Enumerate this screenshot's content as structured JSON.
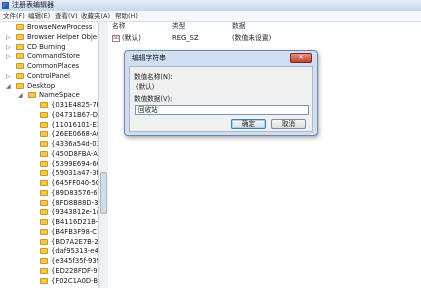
{
  "window": {
    "title": "注册表编辑器"
  },
  "menu": [
    "文件(F)",
    "编辑(E)",
    "查看(V)",
    "收藏夹(A)",
    "帮助(H)"
  ],
  "tree": {
    "items": [
      {
        "label": "BrowseNewProcess",
        "expander": ""
      },
      {
        "label": "Browser Helper Obje",
        "expander": "▷"
      },
      {
        "label": "CD Burning",
        "expander": "▷"
      },
      {
        "label": "CommandStore",
        "expander": "▷"
      },
      {
        "label": "CommonPlaces",
        "expander": ""
      },
      {
        "label": "ControlPanel",
        "expander": "▷"
      },
      {
        "label": "Desktop",
        "expander": "◢"
      },
      {
        "label": "NameSpace",
        "expander": "◢"
      },
      {
        "label": "{031E4825-7B9",
        "expander": ""
      },
      {
        "label": "{04731B67-D9",
        "expander": ""
      },
      {
        "label": "{11016101-E36",
        "expander": ""
      },
      {
        "label": "{26EE0668-A00",
        "expander": ""
      },
      {
        "label": "{4336a54d-038",
        "expander": ""
      },
      {
        "label": "{450D8FBA-AD",
        "expander": ""
      },
      {
        "label": "{5399E694-6CE",
        "expander": ""
      },
      {
        "label": "{59031a47-3f7",
        "expander": ""
      },
      {
        "label": "{645FF040-508",
        "expander": ""
      },
      {
        "label": "{89D83576-6B",
        "expander": ""
      },
      {
        "label": "{8FD8B88D-30",
        "expander": ""
      },
      {
        "label": "{9343812e-1c3",
        "expander": ""
      },
      {
        "label": "{B4116D21B-3E",
        "expander": ""
      },
      {
        "label": "{B4FB3F98-C1E",
        "expander": ""
      },
      {
        "label": "{BD7A2E7B-21",
        "expander": ""
      },
      {
        "label": "{daf95313-e44",
        "expander": ""
      },
      {
        "label": "{e345f35f-939",
        "expander": ""
      },
      {
        "label": "{ED228FDF-9E",
        "expander": ""
      },
      {
        "label": "{F02C1A0D-BE",
        "expander": ""
      }
    ]
  },
  "values_pane": {
    "columns": [
      "名称",
      "类型",
      "数据"
    ],
    "rows": [
      {
        "name": "(默认)",
        "type": "REG_SZ",
        "data": "(数值未设置)",
        "icon": "ab-string-icon"
      }
    ]
  },
  "dialog": {
    "title": "编辑字符串",
    "close_label": "✕",
    "name_label": "数值名称(N):",
    "name_value": "(默认)",
    "data_label": "数值数据(V):",
    "data_value": "回收站",
    "ok_label": "确定",
    "cancel_label": "取消"
  },
  "colors": {
    "titlebar": "#c6d8ee",
    "dialog_frame": "#cfdff1",
    "folder": "#f0c850",
    "close": "#c4432b"
  }
}
